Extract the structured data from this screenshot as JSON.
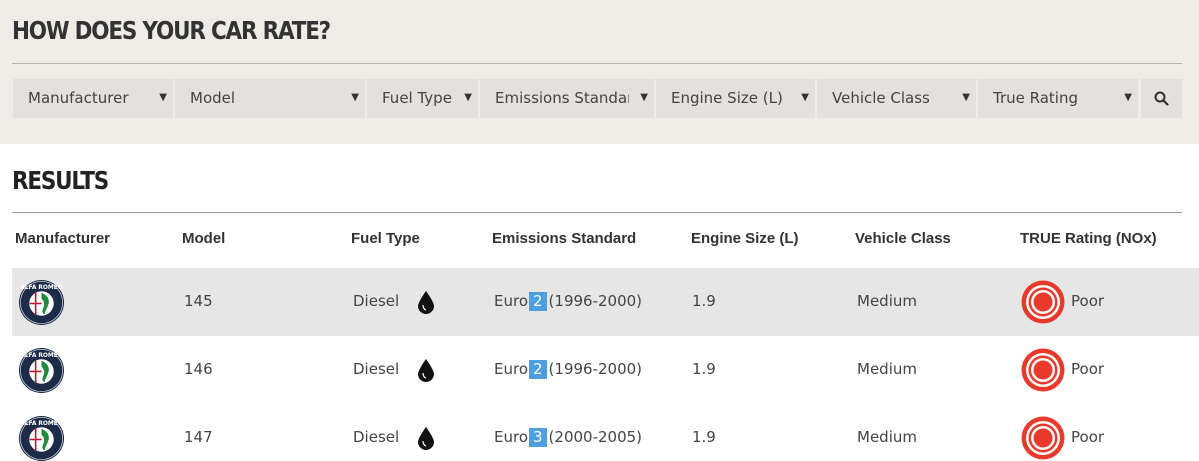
{
  "page": {
    "title": "HOW DOES YOUR CAR RATE?"
  },
  "filters": [
    {
      "label": "Manufacturer"
    },
    {
      "label": "Model"
    },
    {
      "label": "Fuel Type"
    },
    {
      "label": "Emissions Standar"
    },
    {
      "label": "Engine Size (L)"
    },
    {
      "label": "Vehicle Class"
    },
    {
      "label": "True Rating"
    }
  ],
  "search_icon": "search-icon",
  "results": {
    "title": "RESULTS",
    "columns": [
      "Manufacturer",
      "Model",
      "Fuel Type",
      "Emissions Standard",
      "Engine Size (L)",
      "Vehicle Class",
      "TRUE Rating (NOx)"
    ],
    "rows": [
      {
        "logo_text": "ALFA ROMEO",
        "model": "145",
        "fuel": "Diesel",
        "emissions_prefix": "Euro",
        "euro_level": "2",
        "emissions_years": "(1996-2000)",
        "engine": "1.9",
        "vehicle_class": "Medium",
        "rating": "Poor"
      },
      {
        "logo_text": "ALFA ROMEO",
        "model": "146",
        "fuel": "Diesel",
        "emissions_prefix": "Euro",
        "euro_level": "2",
        "emissions_years": "(1996-2000)",
        "engine": "1.9",
        "vehicle_class": "Medium",
        "rating": "Poor"
      },
      {
        "logo_text": "ALFA ROMEO",
        "model": "147",
        "fuel": "Diesel",
        "emissions_prefix": "Euro",
        "euro_level": "3",
        "emissions_years": "(2000-2005)",
        "engine": "1.9",
        "vehicle_class": "Medium",
        "rating": "Poor"
      }
    ]
  },
  "colors": {
    "panel_bg": "#efebe7",
    "euro_badge": "#4d9fe0",
    "rating_poor": "#e8392a",
    "logo_navy": "#1c2b48"
  }
}
